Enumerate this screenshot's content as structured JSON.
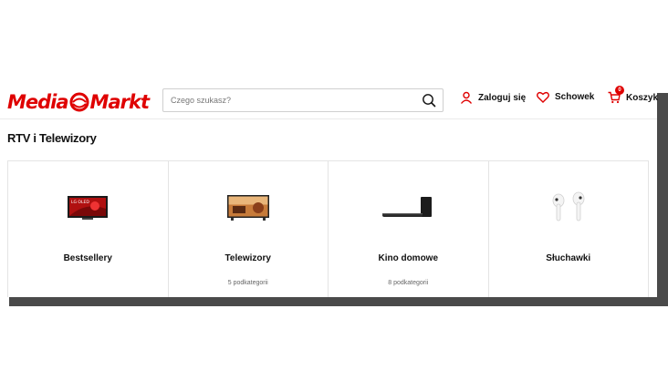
{
  "header": {
    "logo_text_left": "Media",
    "logo_text_right": "Markt",
    "search_placeholder": "Czego szukasz?",
    "login_label": "Zaloguj się",
    "wishlist_label": "Schowek",
    "cart_label": "Koszyk",
    "cart_count": "0"
  },
  "page": {
    "title": "RTV i Telewizory"
  },
  "categories": [
    {
      "name": "Bestsellery",
      "subtitle": "",
      "icon": "lg-oled-tv-icon",
      "image_text": "LG OLED"
    },
    {
      "name": "Telewizory",
      "subtitle": "5 podkategorii",
      "icon": "tv-icon"
    },
    {
      "name": "Kino domowe",
      "subtitle": "8 podkategorii",
      "icon": "soundbar-icon"
    },
    {
      "name": "Słuchawki",
      "subtitle": "",
      "icon": "earbuds-icon"
    }
  ],
  "colors": {
    "brand_red": "#df0000",
    "text": "#111111",
    "border": "#e4e4e4"
  }
}
